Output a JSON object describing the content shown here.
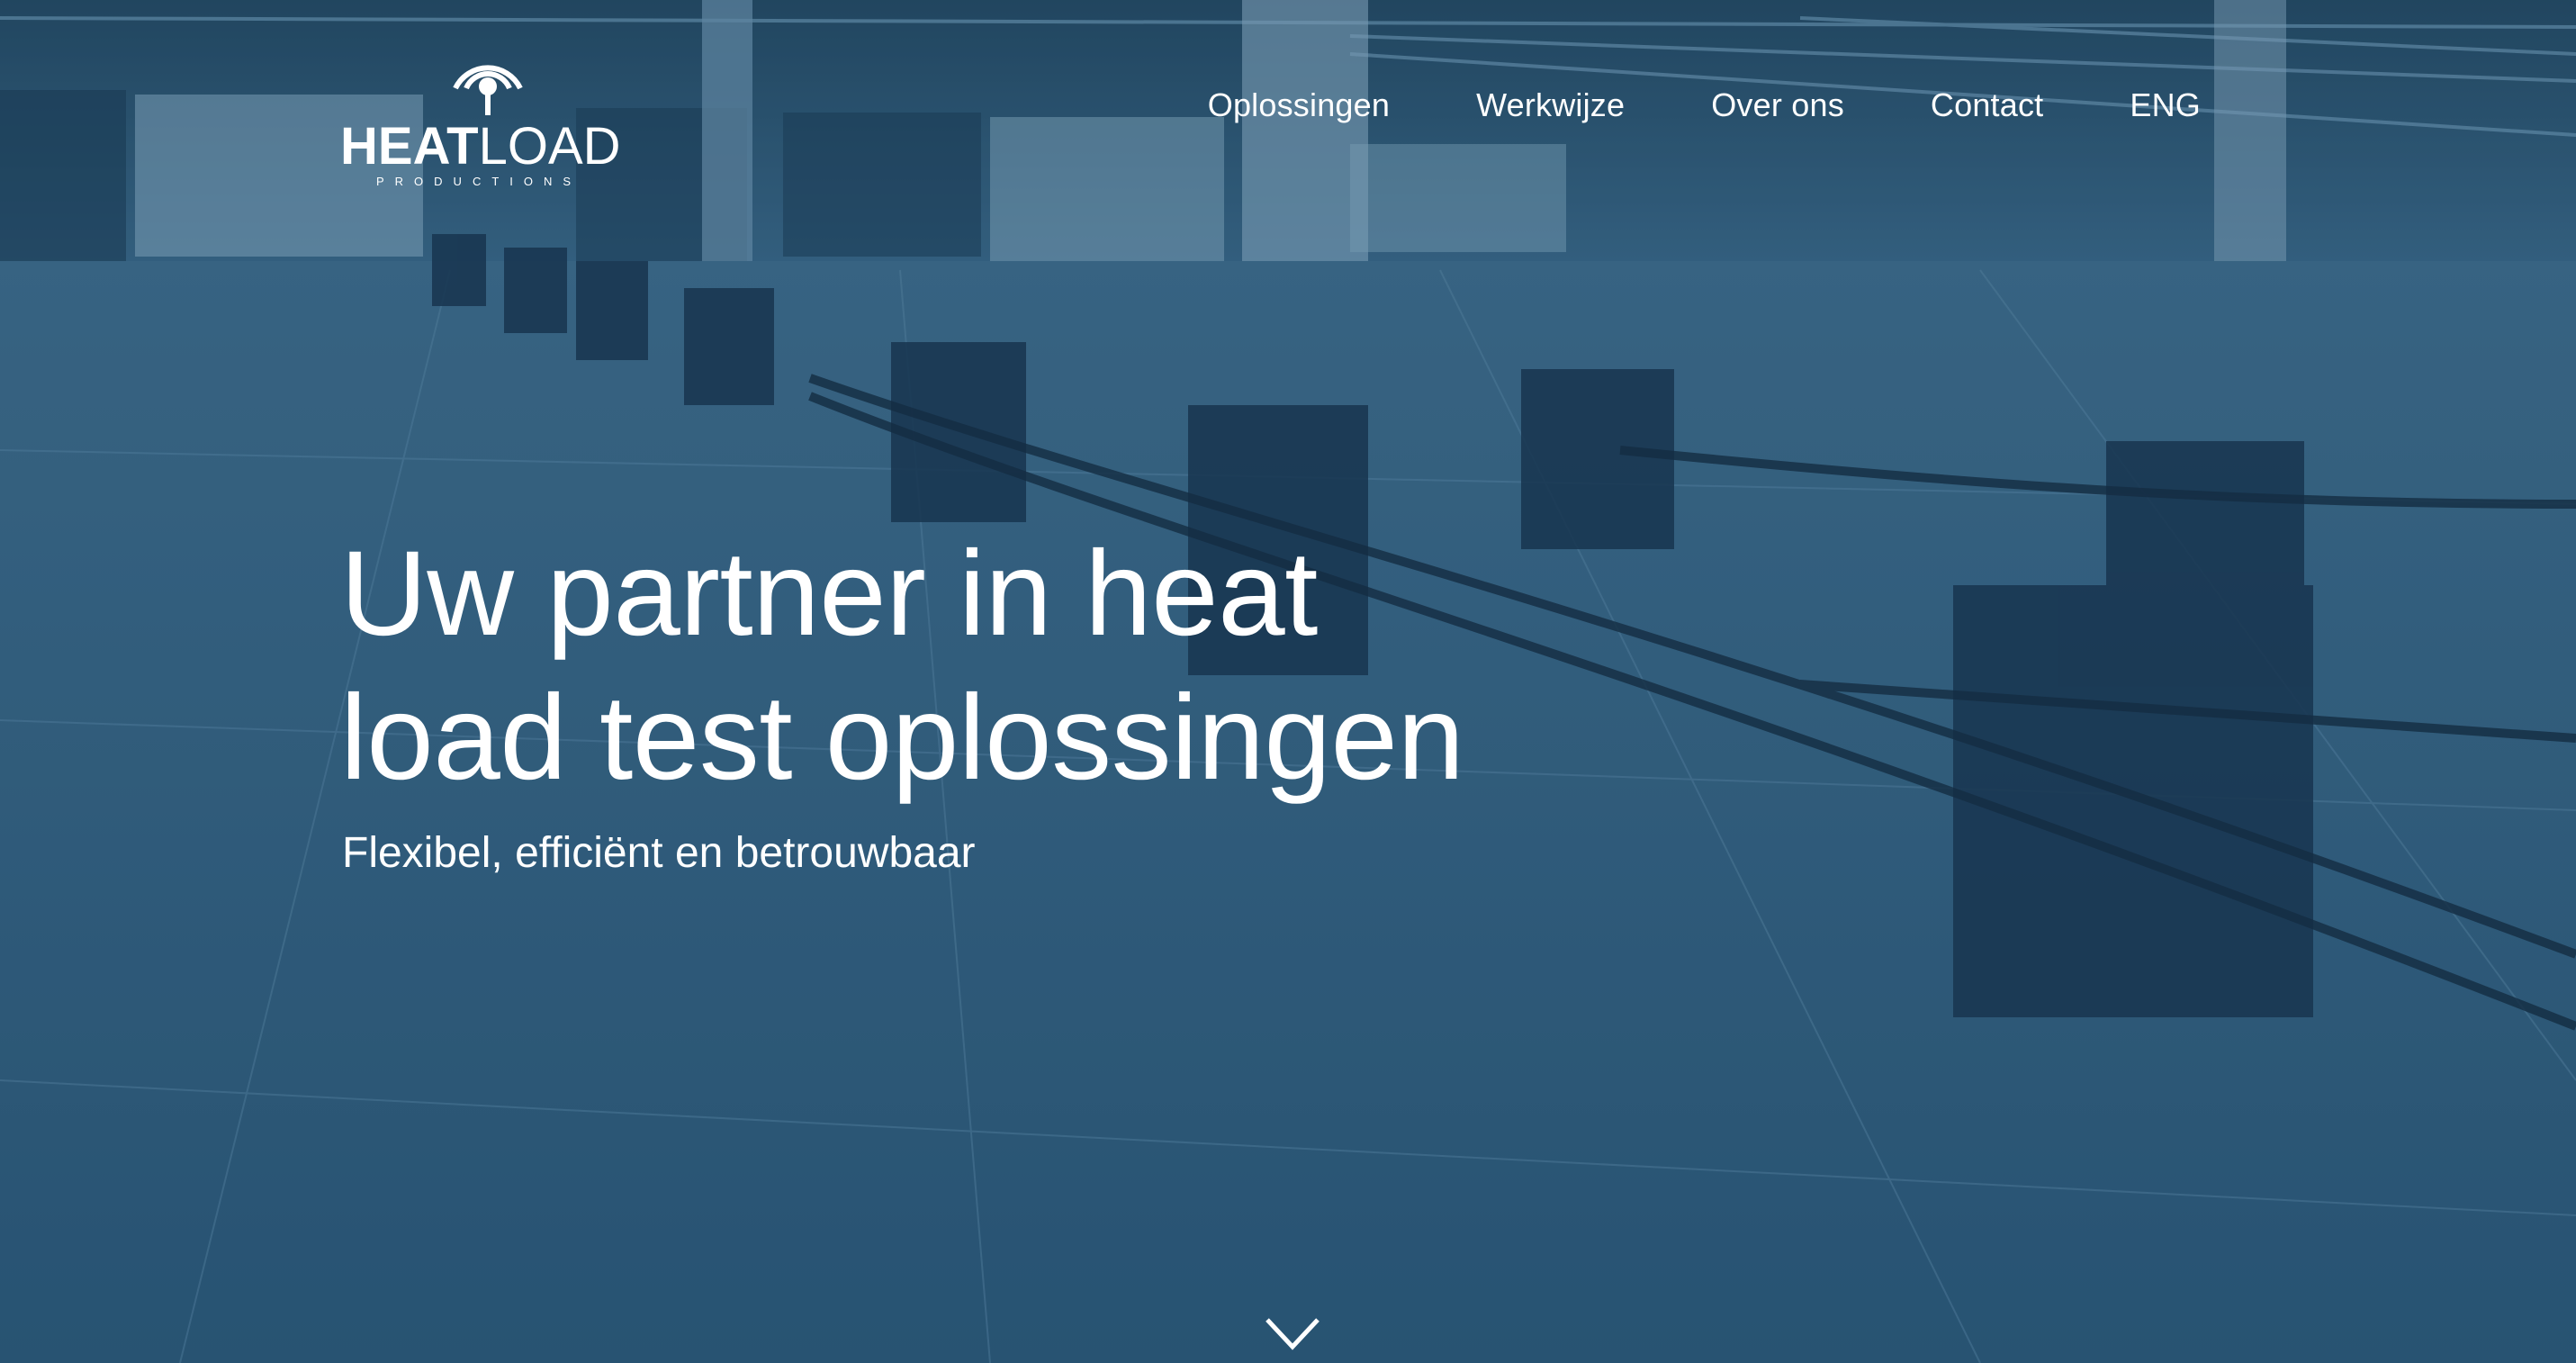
{
  "brand": {
    "name_bold": "HEAT",
    "name_light": "LOAD",
    "tagline": "PRODUCTIONS",
    "logo_icon": "heat-signal-icon"
  },
  "nav": {
    "items": [
      {
        "label": "Oplossingen"
      },
      {
        "label": "Werkwijze"
      },
      {
        "label": "Over ons"
      },
      {
        "label": "Contact"
      },
      {
        "label": "ENG"
      }
    ]
  },
  "hero": {
    "headline_line1": "Uw partner in heat",
    "headline_line2": "load test oplossingen",
    "subheadline": "Flexibel, efficiënt en betrouwbaar",
    "scroll_icon": "chevron-down-icon",
    "background_image": "data-center-heaters-photo"
  },
  "colors": {
    "overlay": "#2c5877",
    "text": "#ffffff"
  }
}
